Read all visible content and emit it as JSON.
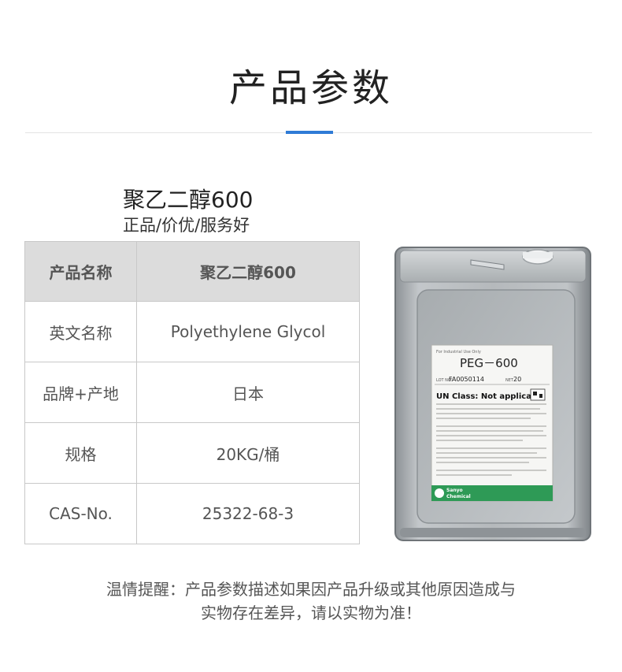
{
  "header": {
    "title": "产品参数",
    "accent_color": "#2f7bd6"
  },
  "product": {
    "name": "聚乙二醇600",
    "tagline": "正品/价优/服务好"
  },
  "specs": {
    "header": {
      "label": "产品名称",
      "value": "聚乙二醇600"
    },
    "rows": [
      {
        "label": "英文名称",
        "value": "Polyethylene Glycol"
      },
      {
        "label": "品牌+产地",
        "value": "日本"
      },
      {
        "label": "规格",
        "value": "20KG/桶"
      },
      {
        "label": "CAS-No.",
        "value": "25322-68-3"
      }
    ]
  },
  "image": {
    "label_lines": {
      "top_left": "For Industrial Use Only",
      "name": "PEG－600",
      "lot_prefix": "LOT NO.",
      "lot": "FA0050114",
      "net_prefix": "NET",
      "net": "20",
      "un_class": "UN Class: Not applicable",
      "brand_line1": "Sanyo",
      "brand_line2": "Chemical"
    }
  },
  "notice": {
    "line1": "温情提醒：产品参数描述如果因产品升级或其他原因造成与",
    "line2": "实物存在差异，请以实物为准！"
  }
}
